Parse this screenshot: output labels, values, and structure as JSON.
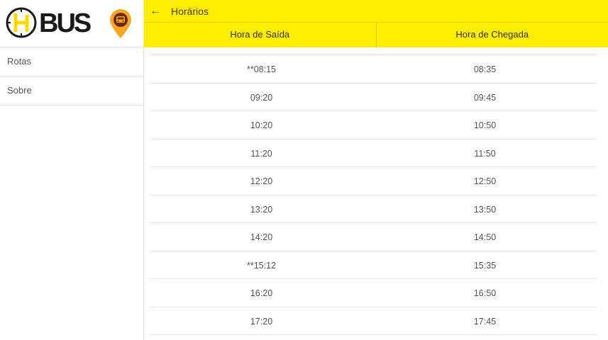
{
  "app": {
    "logo_text": "BUS",
    "header_title": "Horários"
  },
  "colors": {
    "accent": "#ffee00",
    "pin": "#f5a623"
  },
  "sidebar": {
    "items": [
      {
        "label": "Rotas"
      },
      {
        "label": "Sobre"
      }
    ]
  },
  "table": {
    "headers": [
      "Hora de Saída",
      "Hora de Chegada"
    ],
    "rows": [
      [
        "**08:15",
        "08:35"
      ],
      [
        "09:20",
        "09:45"
      ],
      [
        "10:20",
        "10:50"
      ],
      [
        "11:20",
        "11:50"
      ],
      [
        "12:20",
        "12:50"
      ],
      [
        "13:20",
        "13:50"
      ],
      [
        "14:20",
        "14:50"
      ],
      [
        "**15:12",
        "15:35"
      ],
      [
        "16:20",
        "16:50"
      ],
      [
        "17:20",
        "17:45"
      ]
    ]
  }
}
